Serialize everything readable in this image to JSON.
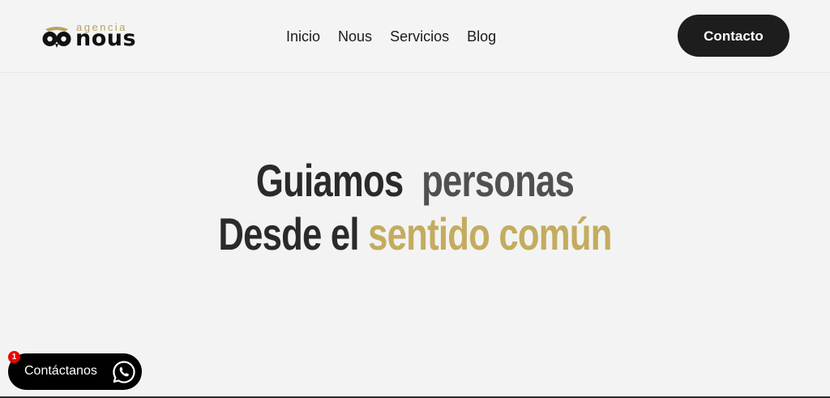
{
  "header": {
    "logo": {
      "small_text": "agencia",
      "big_text": "nous",
      "mark_icon": "owl-eyes-icon",
      "gold": "#b8a163"
    },
    "nav": [
      {
        "label": "Inicio"
      },
      {
        "label": "Nous"
      },
      {
        "label": "Servicios"
      },
      {
        "label": "Blog"
      }
    ],
    "contact_label": "Contacto"
  },
  "hero": {
    "line1": {
      "word1": "Guiamos",
      "word2": "personas"
    },
    "line2": {
      "word1": "Desde el",
      "word2": "sentido común"
    },
    "colors": {
      "dark": "#2a2a2a",
      "gray": "#505050",
      "gold": "#c3ac5e"
    }
  },
  "whatsapp": {
    "label": "Contáctanos",
    "badge": "1",
    "icon": "whatsapp-icon"
  }
}
